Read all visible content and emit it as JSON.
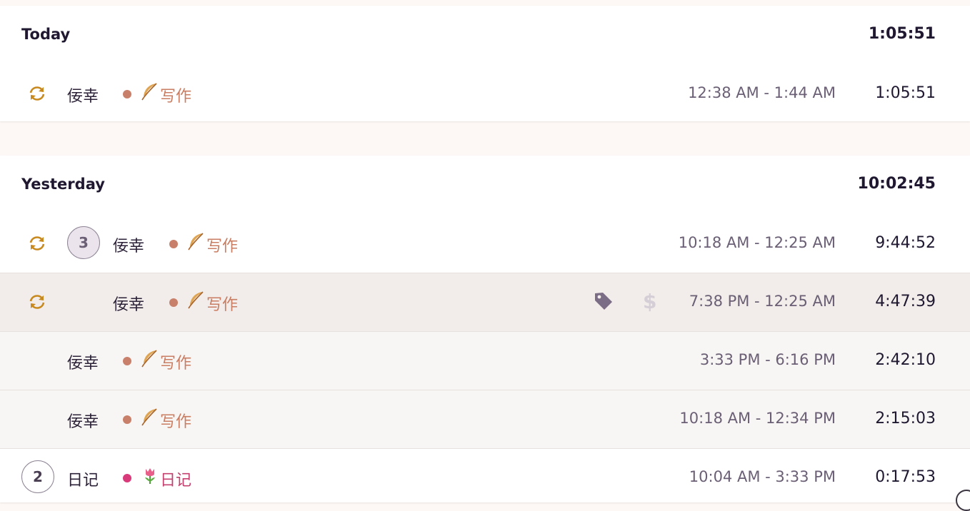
{
  "groups": [
    {
      "title": "Today",
      "total": "1:05:51",
      "entries": [
        {
          "description": "佞幸",
          "project": "写作",
          "project_color": "#c97d62",
          "project_dot": "#c9806a",
          "project_icon": "feather-icon",
          "time_range": "12:38 AM - 1:44 AM",
          "duration": "1:05:51"
        }
      ]
    },
    {
      "title": "Yesterday",
      "total": "10:02:45",
      "entries": [
        {
          "count": "3",
          "description": "佞幸",
          "project": "写作",
          "project_color": "#c97d62",
          "project_dot": "#c9806a",
          "project_icon": "feather-icon",
          "time_range": "10:18 AM - 12:25 AM",
          "duration": "9:44:52"
        },
        {
          "description": "佞幸",
          "project": "写作",
          "project_color": "#c97d62",
          "project_dot": "#c9806a",
          "project_icon": "feather-icon",
          "time_range": "7:38 PM - 12:25 AM",
          "duration": "4:47:39",
          "tag_icon": "tag-icon",
          "billable_icon": "dollar-icon",
          "billable_symbol": "$"
        },
        {
          "description": "佞幸",
          "project": "写作",
          "project_color": "#c97d62",
          "project_dot": "#c9806a",
          "project_icon": "feather-icon",
          "time_range": "3:33 PM - 6:16 PM",
          "duration": "2:42:10"
        },
        {
          "description": "佞幸",
          "project": "写作",
          "project_color": "#c97d62",
          "project_dot": "#c9806a",
          "project_icon": "feather-icon",
          "time_range": "10:18 AM - 12:34 PM",
          "duration": "2:15:03"
        },
        {
          "count": "2",
          "description": "日记",
          "project": "日记",
          "project_color": "#c2416f",
          "project_dot": "#d83a7a",
          "project_icon": "tulip-icon",
          "time_range": "10:04 AM - 3:33 PM",
          "duration": "0:17:53"
        }
      ]
    }
  ],
  "colors": {
    "background": "#fdf8f5",
    "refresh_icon": "#c8891f",
    "hover_row": "#f2edea",
    "sub_row": "#f8f6f4"
  }
}
